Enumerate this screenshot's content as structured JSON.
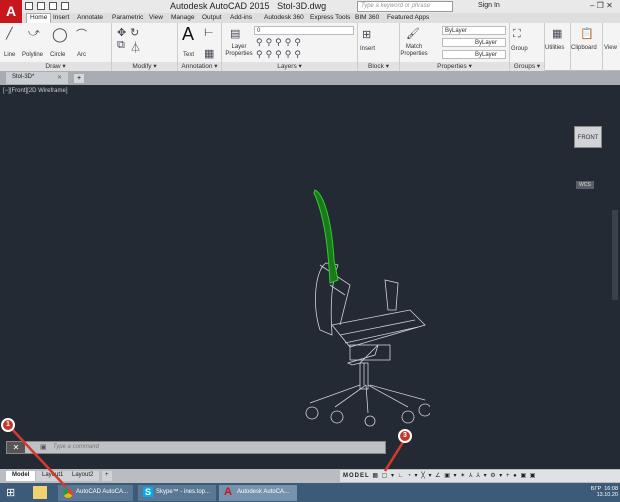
{
  "app": {
    "title": "Autodesk AutoCAD 2015",
    "file": "Stol-3D.dwg",
    "search_placeholder": "Type a keyword or phrase",
    "sign_in": "Sign In"
  },
  "ribbon_tabs": [
    "Home",
    "Insert",
    "Annotate",
    "Parametric",
    "View",
    "Manage",
    "Output",
    "Add-ins",
    "Autodesk 360",
    "Express Tools",
    "BIM 360",
    "Featured Apps"
  ],
  "panels": {
    "draw": "Draw ▾",
    "modify": "Modify ▾",
    "annotation": "Annotation ▾",
    "layers": "Layers ▾",
    "block": "Block ▾",
    "properties": "Properties ▾",
    "groups": "Groups ▾"
  },
  "tools": {
    "line": "Line",
    "polyline": "Polyline",
    "circle": "Circle",
    "arc": "Arc",
    "text": "Text",
    "layer_properties": "Layer Properties",
    "insert": "Insert",
    "match_properties": "Match Properties",
    "group": "Group",
    "utilities": "Utilities",
    "clipboard": "Clipboard",
    "view": "View"
  },
  "layer_combo": "0",
  "prop_color": "ByLayer",
  "prop_linetype": "ByLayer",
  "prop_lineweight": "ByLayer",
  "file_tab": "Stol-3D*",
  "viewport_label": "[−][Front][2D Wireframe]",
  "viewcube": "FRONT",
  "wcs": "WCS",
  "command_placeholder": "Type a command",
  "layout_tabs": [
    "Model",
    "Layout1",
    "Layout2"
  ],
  "status": {
    "model": "MODEL"
  },
  "taskbar": [
    "AutoCAD AutoCA...",
    "Skype™ - ines.top...",
    "Autodesk AutoCA..."
  ],
  "tray": {
    "lang": "БГР",
    "time": "16:08",
    "date": "13.10.20"
  },
  "callouts": [
    "1",
    "3"
  ],
  "colors": {
    "accent": "#c8171c",
    "selection": "#22cc22",
    "viewport": "#242a33"
  }
}
